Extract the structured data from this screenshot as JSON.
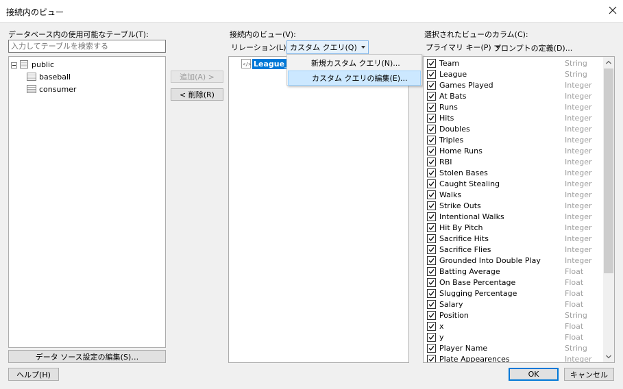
{
  "window": {
    "title": "接続内のビュー"
  },
  "left": {
    "label": "データベース内の使用可能なテーブル(T):",
    "search_placeholder": "入力してテーブルを検索する",
    "tree": {
      "schema": "public",
      "tables": [
        "baseball",
        "consumer"
      ]
    },
    "edit_source_button": "データ ソース設定の編集(S)…"
  },
  "middle": {
    "add_button": "追加(A) >",
    "remove_button": "< 削除(R)",
    "label": "接続内のビュー(V):",
    "relation_dropdown": "リレーション(L)",
    "custom_query_dropdown": "カスタム クエリ(Q)",
    "view_item": "League_",
    "menu": {
      "new_query": "新規カスタム クエリ(N)...",
      "edit_query": "カスタム クエリの編集(E)..."
    }
  },
  "right": {
    "label": "選択されたビューのカラム(C):",
    "primary_key_dropdown": "プライマリ キー(P)",
    "prompt_definition": "プロンプトの定義(D)...",
    "columns": [
      {
        "name": "Team",
        "type": "String"
      },
      {
        "name": "League",
        "type": "String"
      },
      {
        "name": "Games Played",
        "type": "Integer"
      },
      {
        "name": "At Bats",
        "type": "Integer"
      },
      {
        "name": "Runs",
        "type": "Integer"
      },
      {
        "name": "Hits",
        "type": "Integer"
      },
      {
        "name": "Doubles",
        "type": "Integer"
      },
      {
        "name": "Triples",
        "type": "Integer"
      },
      {
        "name": "Home Runs",
        "type": "Integer"
      },
      {
        "name": "RBI",
        "type": "Integer"
      },
      {
        "name": "Stolen Bases",
        "type": "Integer"
      },
      {
        "name": "Caught Stealing",
        "type": "Integer"
      },
      {
        "name": "Walks",
        "type": "Integer"
      },
      {
        "name": "Strike Outs",
        "type": "Integer"
      },
      {
        "name": "Intentional Walks",
        "type": "Integer"
      },
      {
        "name": "Hit By Pitch",
        "type": "Integer"
      },
      {
        "name": "Sacrifice Hits",
        "type": "Integer"
      },
      {
        "name": "Sacrifice Flies",
        "type": "Integer"
      },
      {
        "name": "Grounded Into Double Play",
        "type": "Integer"
      },
      {
        "name": "Batting Average",
        "type": "Float"
      },
      {
        "name": "On Base Percentage",
        "type": "Float"
      },
      {
        "name": "Slugging Percentage",
        "type": "Float"
      },
      {
        "name": "Salary",
        "type": "Float"
      },
      {
        "name": "Position",
        "type": "String"
      },
      {
        "name": "x",
        "type": "Float"
      },
      {
        "name": "y",
        "type": "Float"
      },
      {
        "name": "Player Name",
        "type": "String"
      },
      {
        "name": "Plate Appearences",
        "type": "Integer"
      }
    ]
  },
  "footer": {
    "help": "ヘルプ(H)",
    "ok": "OK",
    "cancel": "キャンセル"
  }
}
